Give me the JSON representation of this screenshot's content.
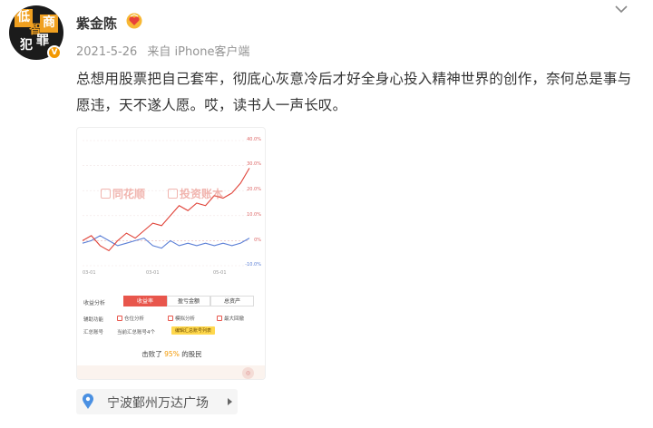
{
  "author": {
    "name": "紫金陈",
    "avatar_glyphs": [
      "低",
      "智",
      "商",
      "犯",
      "罪"
    ],
    "verified_badge": "V",
    "medal_icon": "heart-medal-icon"
  },
  "post": {
    "date": "2021-5-26",
    "source": "来自 iPhone客户端",
    "text": "总想用股票把自己套牢，彻底心灰意冷后才好全身心投入精神世界的创作，奈何总是事与愿违，天不遂人愿。哎，读书人一声长叹。"
  },
  "screenshot": {
    "watermark_1": "同花顺",
    "watermark_2": "投资账本",
    "y_ticks": [
      "40.0%",
      "30.0%",
      "20.0%",
      "10.0%",
      "0%",
      "-10.0%"
    ],
    "x_ticks": [
      "03-01",
      "03-01",
      "05-01"
    ],
    "tabs_label": "收益分析",
    "tabs": [
      "收益率",
      "盈亏金额",
      "总资产"
    ],
    "aux_label": "辅助功能",
    "aux_options": [
      "仓位分析",
      "模拟分析",
      "最大回撤"
    ],
    "account_label": "汇总账号",
    "account_value": "当前汇总账号4个",
    "edit_button": "编辑汇总账号列表",
    "beat_prefix": "击败了",
    "beat_percent": "95%",
    "beat_suffix": "的股民",
    "colors": {
      "user_line": "#e0443a",
      "benchmark_line": "#5b7fd6"
    }
  },
  "location": {
    "name": "宁波鄞州万达广场",
    "icon": "map-pin-icon"
  },
  "chart_data": {
    "type": "line",
    "ylim": [
      -10,
      40
    ],
    "x": [
      0,
      10,
      20,
      30,
      40,
      50,
      60,
      70,
      80,
      90,
      100,
      110,
      120,
      130,
      140,
      150,
      160,
      170,
      180,
      190
    ],
    "series": [
      {
        "name": "收益率",
        "values": [
          0,
          2,
          -2,
          -4,
          0,
          3,
          1,
          4,
          7,
          6,
          10,
          14,
          12,
          15,
          14,
          18,
          17,
          19,
          23,
          29
        ]
      },
      {
        "name": "",
        "values": [
          -1,
          0,
          2,
          0,
          -2,
          -1,
          0,
          1,
          -2,
          -3,
          0,
          -2,
          -1,
          -2,
          -1,
          -2,
          -1,
          -2,
          -1,
          1
        ]
      }
    ]
  }
}
